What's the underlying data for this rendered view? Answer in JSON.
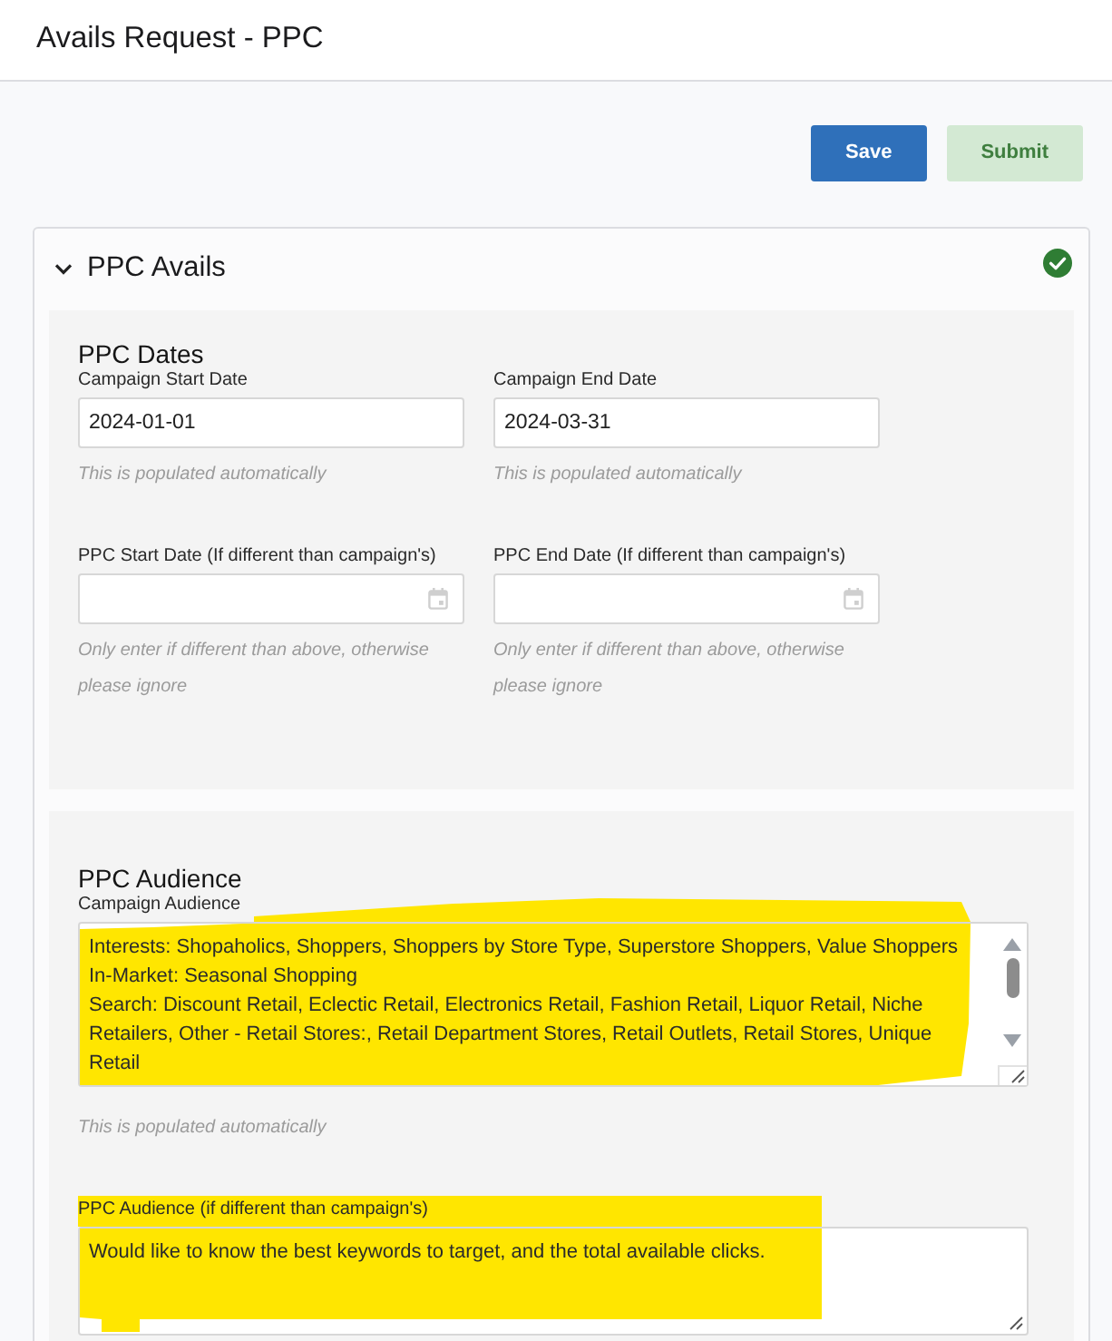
{
  "page": {
    "title": "Avails Request - PPC"
  },
  "actions": [
    {
      "label": "Save",
      "kind": "primary",
      "disabled": false
    },
    {
      "label": "Submit",
      "kind": "success",
      "disabled": true
    }
  ],
  "section": {
    "title": "PPC Avails",
    "expanded": true,
    "complete": true,
    "panels": [
      {
        "title": "PPC Dates",
        "fields": [
          {
            "kind": "text",
            "label": "Campaign Start Date",
            "value": "2024-01-01",
            "help": "This is populated automatically"
          },
          {
            "kind": "text",
            "label": "Campaign End Date",
            "value": "2024-03-31",
            "help": "This is populated automatically"
          },
          {
            "kind": "date",
            "label": "PPC Start Date (If different than campaign's)",
            "help": "Only enter if different than above, otherwise please ignore"
          },
          {
            "kind": "date",
            "label": "PPC End Date (If different than campaign's)",
            "help": "Only enter if different than above, otherwise please ignore"
          }
        ]
      },
      {
        "title": "PPC Audience",
        "fields": [
          {
            "kind": "textarea",
            "label": "Campaign Audience",
            "value": "Interests: Shopaholics, Shoppers, Shoppers by Store Type, Superstore Shoppers, Value Shoppers\nIn-Market: Seasonal Shopping\nSearch: Discount Retail, Eclectic Retail, Electronics Retail, Fashion Retail, Liquor Retail, Niche Retailers, Other - Retail Stores:, Retail Department Stores, Retail Outlets, Retail Stores, Unique Retail",
            "help": "This is populated automatically",
            "highlighted": true,
            "scrollbar": true
          },
          {
            "kind": "textarea",
            "label": "PPC Audience (if different than campaign's)",
            "value": "Would like to know the best keywords to target, and the total available clicks.",
            "highlighted": true,
            "scrollbar": false
          }
        ]
      }
    ]
  }
}
